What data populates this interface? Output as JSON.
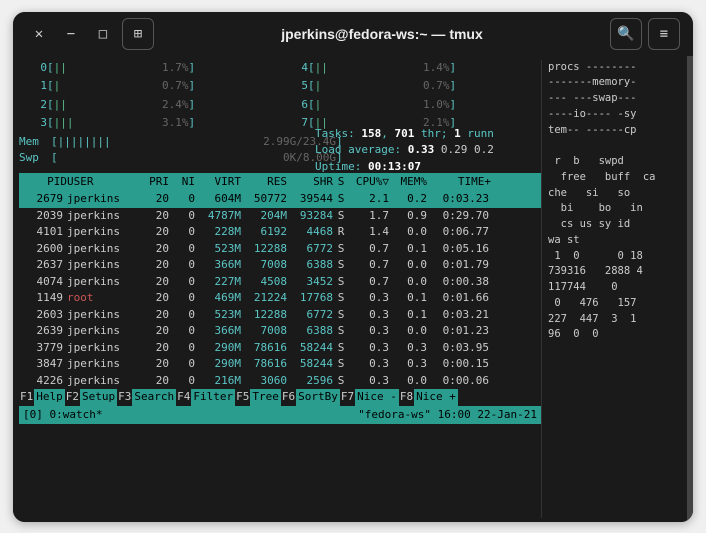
{
  "title": "jperkins@fedora-ws:~ — tmux",
  "cpus": [
    {
      "id": "0",
      "bar": "||",
      "pct": "1.7%"
    },
    {
      "id": "1",
      "bar": "|",
      "pct": "0.7%"
    },
    {
      "id": "2",
      "bar": "||",
      "pct": "2.4%"
    },
    {
      "id": "3",
      "bar": "|||",
      "pct": "3.1%"
    },
    {
      "id": "4",
      "bar": "||",
      "pct": "1.4%"
    },
    {
      "id": "5",
      "bar": "|",
      "pct": "0.7%"
    },
    {
      "id": "6",
      "bar": "|",
      "pct": "1.0%"
    },
    {
      "id": "7",
      "bar": "||",
      "pct": "2.1%"
    }
  ],
  "mem": {
    "label": "Mem",
    "bar": "||||||||",
    "text": "2.99G/23.4G"
  },
  "swp": {
    "label": "Swp",
    "bar": "",
    "text": "0K/8.00G"
  },
  "tasks_line": {
    "prefix": "Tasks: ",
    "tasks": "158",
    "sep1": ", ",
    "thr": "701",
    "thr_lbl": " thr; ",
    "run": "1",
    "run_lbl": " runn"
  },
  "load_line": {
    "prefix": "Load average: ",
    "v1": "0.33",
    "v2": "0.29",
    "v3": "0.2"
  },
  "uptime_line": {
    "prefix": "Uptime: ",
    "val": "00:13:07"
  },
  "headers": {
    "pid": "PID",
    "user": "USER",
    "pri": "PRI",
    "ni": "NI",
    "virt": "VIRT",
    "res": "RES",
    "shr": "SHR",
    "s": "S",
    "cpu": "CPU%▽",
    "mem": "MEM%",
    "time": "TIME+"
  },
  "processes": [
    {
      "pid": "2679",
      "user": "jperkins",
      "pri": "20",
      "ni": "0",
      "virt": "604M",
      "res": "50772",
      "shr": "39544",
      "s": "S",
      "cpu": "2.1",
      "mem": "0.2",
      "time": "0:03.23",
      "sel": true
    },
    {
      "pid": "2039",
      "user": "jperkins",
      "pri": "20",
      "ni": "0",
      "virt": "4787M",
      "res": "204M",
      "shr": "93284",
      "s": "S",
      "cpu": "1.7",
      "mem": "0.9",
      "time": "0:29.70"
    },
    {
      "pid": "4101",
      "user": "jperkins",
      "pri": "20",
      "ni": "0",
      "virt": "228M",
      "res": "6192",
      "shr": "4468",
      "s": "R",
      "cpu": "1.4",
      "mem": "0.0",
      "time": "0:06.77"
    },
    {
      "pid": "2600",
      "user": "jperkins",
      "pri": "20",
      "ni": "0",
      "virt": "523M",
      "res": "12288",
      "shr": "6772",
      "s": "S",
      "cpu": "0.7",
      "mem": "0.1",
      "time": "0:05.16"
    },
    {
      "pid": "2637",
      "user": "jperkins",
      "pri": "20",
      "ni": "0",
      "virt": "366M",
      "res": "7008",
      "shr": "6388",
      "s": "S",
      "cpu": "0.7",
      "mem": "0.0",
      "time": "0:01.79"
    },
    {
      "pid": "4074",
      "user": "jperkins",
      "pri": "20",
      "ni": "0",
      "virt": "227M",
      "res": "4508",
      "shr": "3452",
      "s": "S",
      "cpu": "0.7",
      "mem": "0.0",
      "time": "0:00.38"
    },
    {
      "pid": "1149",
      "user": "root",
      "pri": "20",
      "ni": "0",
      "virt": "469M",
      "res": "21224",
      "shr": "17768",
      "s": "S",
      "cpu": "0.3",
      "mem": "0.1",
      "time": "0:01.66",
      "root": true
    },
    {
      "pid": "2603",
      "user": "jperkins",
      "pri": "20",
      "ni": "0",
      "virt": "523M",
      "res": "12288",
      "shr": "6772",
      "s": "S",
      "cpu": "0.3",
      "mem": "0.1",
      "time": "0:03.21"
    },
    {
      "pid": "2639",
      "user": "jperkins",
      "pri": "20",
      "ni": "0",
      "virt": "366M",
      "res": "7008",
      "shr": "6388",
      "s": "S",
      "cpu": "0.3",
      "mem": "0.0",
      "time": "0:01.23"
    },
    {
      "pid": "3779",
      "user": "jperkins",
      "pri": "20",
      "ni": "0",
      "virt": "290M",
      "res": "78616",
      "shr": "58244",
      "s": "S",
      "cpu": "0.3",
      "mem": "0.3",
      "time": "0:03.95"
    },
    {
      "pid": "3847",
      "user": "jperkins",
      "pri": "20",
      "ni": "0",
      "virt": "290M",
      "res": "78616",
      "shr": "58244",
      "s": "S",
      "cpu": "0.3",
      "mem": "0.3",
      "time": "0:00.15"
    },
    {
      "pid": "4226",
      "user": "jperkins",
      "pri": "20",
      "ni": "0",
      "virt": "216M",
      "res": "3060",
      "shr": "2596",
      "s": "S",
      "cpu": "0.3",
      "mem": "0.0",
      "time": "0:00.06"
    }
  ],
  "fkeys": [
    {
      "k": "F1",
      "l": "Help"
    },
    {
      "k": "F2",
      "l": "Setup"
    },
    {
      "k": "F3",
      "l": "Search"
    },
    {
      "k": "F4",
      "l": "Filter"
    },
    {
      "k": "F5",
      "l": "Tree"
    },
    {
      "k": "F6",
      "l": "SortBy"
    },
    {
      "k": "F7",
      "l": "Nice -"
    },
    {
      "k": "F8",
      "l": "Nice +"
    }
  ],
  "tmux": {
    "left": "[0] 0:watch*",
    "right": "\"fedora-ws\" 16:00 22-Jan-21"
  },
  "vmstat": {
    "lines": [
      "procs --------",
      "-------memory-",
      "--- ---swap---",
      "----io---- -sy",
      "tem-- ------cp",
      "",
      " r  b   swpd",
      "  free   buff  ca",
      "che   si   so",
      "  bi    bo   in",
      "  cs us sy id",
      "wa st",
      " 1  0      0 18",
      "739316   2888 4",
      "117744    0",
      " 0   476   157",
      "227  447  3  1",
      "96  0  0"
    ]
  }
}
